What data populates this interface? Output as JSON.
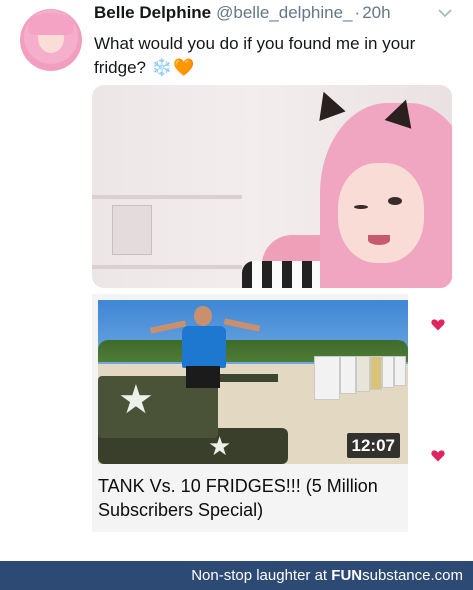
{
  "tweet": {
    "display_name": "Belle Delphine",
    "handle": "@belle_delphine_",
    "separator": "·",
    "time": "20h",
    "text": "What would you do if you found me in your fridge?",
    "emoji_snowflake": "❄️",
    "emoji_heart": "🧡"
  },
  "video": {
    "duration": "12:07",
    "title": "TANK Vs. 10 FRIDGES!!! (5 Million Subscribers Special)"
  },
  "footer": {
    "prefix": "Non-stop laughter at",
    "brand_fun": "FUN",
    "brand_rest": "substance.com"
  },
  "colors": {
    "footer_bg": "#2c4a74",
    "heart": "#e0245e",
    "handle_gray": "#657786"
  },
  "icons": [
    "chevron-down-icon",
    "heart-icon"
  ]
}
